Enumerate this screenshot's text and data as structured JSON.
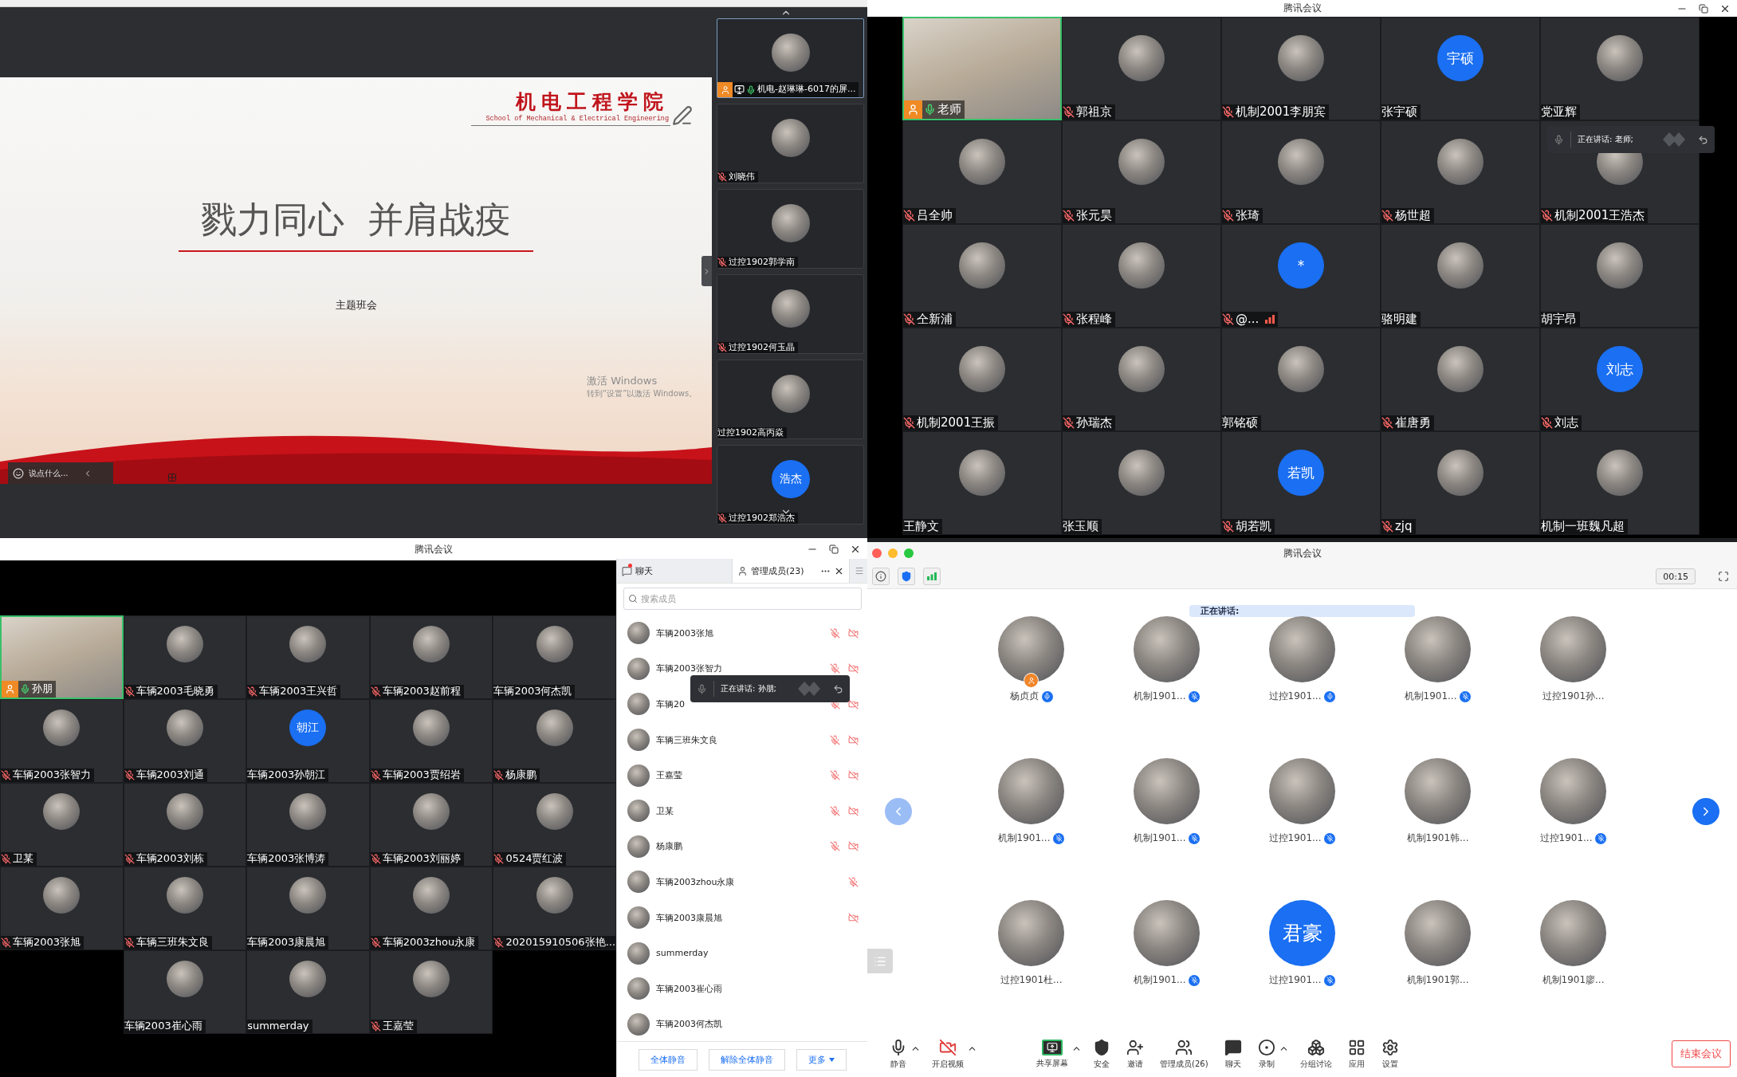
{
  "presentation_window": {
    "slide": {
      "logo_title": "机电工程学院",
      "logo_subtitle": "School of Mechanical & Electrical Engineering",
      "headline": "戮力同心  并肩战疫",
      "subtitle": "主题班会"
    },
    "os_notice": [
      "激活 Windows",
      "转到“设置”以激活 Windows。"
    ],
    "chat_input": {
      "placeholder": "说点什么..."
    },
    "filmstrip": [
      {
        "name": "机电-赵琳琳-6017的屏...",
        "kind": "photo",
        "mic_on": true,
        "mic_muted": false,
        "host": true,
        "sharing": true,
        "speaking": true
      },
      {
        "name": "刘晓伟",
        "kind": "photo",
        "mic_on": false,
        "mic_muted": true,
        "host": false,
        "sharing": false,
        "speaking": false
      },
      {
        "name": "过控1902郭学南",
        "kind": "photo",
        "mic_on": false,
        "mic_muted": true,
        "host": false,
        "sharing": false,
        "speaking": false
      },
      {
        "name": "过控1902何玉晶",
        "kind": "photo",
        "mic_on": false,
        "mic_muted": true,
        "host": false,
        "sharing": false,
        "speaking": false
      },
      {
        "name": "过控1902高丙焱",
        "kind": "photo",
        "mic_on": false,
        "mic_muted": false,
        "host": false,
        "sharing": false,
        "speaking": false
      },
      {
        "name": "过控1902郑浩杰",
        "kind": "initials",
        "initials": "浩杰",
        "mic_on": false,
        "mic_muted": true,
        "host": false,
        "sharing": false,
        "speaking": false
      }
    ]
  },
  "gallery_window_1": {
    "title": "腾讯会议",
    "speaking": "正在讲话: 老师;",
    "tiles": [
      {
        "name": "老师",
        "kind": "video",
        "mic_on": true,
        "mic_muted": false,
        "host": true,
        "speaking": true,
        "poor_network": false
      },
      {
        "name": "郭祖京",
        "kind": "photo",
        "mic_on": false,
        "mic_muted": true,
        "host": false,
        "speaking": false,
        "poor_network": false
      },
      {
        "name": "机制2001李朋宾",
        "kind": "photo",
        "mic_on": false,
        "mic_muted": true,
        "host": false,
        "speaking": false,
        "poor_network": false
      },
      {
        "name": "张宇硕",
        "kind": "initials",
        "initials": "宇硕",
        "mic_on": false,
        "mic_muted": false,
        "host": false,
        "speaking": false,
        "poor_network": false
      },
      {
        "name": "党亚辉",
        "kind": "photo",
        "mic_on": false,
        "mic_muted": false,
        "host": false,
        "speaking": false,
        "poor_network": false
      },
      {
        "name": "吕全帅",
        "kind": "photo",
        "mic_on": false,
        "mic_muted": true,
        "host": false,
        "speaking": false,
        "poor_network": false
      },
      {
        "name": "张元昊",
        "kind": "photo",
        "mic_on": false,
        "mic_muted": true,
        "host": false,
        "speaking": false,
        "poor_network": false
      },
      {
        "name": "张琦",
        "kind": "photo",
        "mic_on": false,
        "mic_muted": true,
        "host": false,
        "speaking": false,
        "poor_network": false
      },
      {
        "name": "杨世超",
        "kind": "photo",
        "mic_on": false,
        "mic_muted": true,
        "host": false,
        "speaking": false,
        "poor_network": false
      },
      {
        "name": "机制2001王浩杰",
        "kind": "photo",
        "mic_on": false,
        "mic_muted": true,
        "host": false,
        "speaking": false,
        "poor_network": false
      },
      {
        "name": "仝新浦",
        "kind": "photo",
        "mic_on": false,
        "mic_muted": true,
        "host": false,
        "speaking": false,
        "poor_network": false
      },
      {
        "name": "张程峰",
        "kind": "photo",
        "mic_on": false,
        "mic_muted": true,
        "host": false,
        "speaking": false,
        "poor_network": false
      },
      {
        "name": "@...",
        "kind": "initials",
        "initials": "*",
        "mic_on": false,
        "mic_muted": true,
        "host": false,
        "speaking": false,
        "poor_network": true
      },
      {
        "name": "骆明建",
        "kind": "photo",
        "mic_on": false,
        "mic_muted": false,
        "host": false,
        "speaking": false,
        "poor_network": false
      },
      {
        "name": "胡宇昂",
        "kind": "photo",
        "mic_on": false,
        "mic_muted": false,
        "host": false,
        "speaking": false,
        "poor_network": false
      },
      {
        "name": "机制2001王振",
        "kind": "photo",
        "mic_on": false,
        "mic_muted": true,
        "host": false,
        "speaking": false,
        "poor_network": false
      },
      {
        "name": "孙瑞杰",
        "kind": "photo",
        "mic_on": false,
        "mic_muted": true,
        "host": false,
        "speaking": false,
        "poor_network": false
      },
      {
        "name": "郭铭硕",
        "kind": "photo",
        "mic_on": false,
        "mic_muted": false,
        "host": false,
        "speaking": false,
        "poor_network": false
      },
      {
        "name": "崔唐勇",
        "kind": "photo",
        "mic_on": false,
        "mic_muted": true,
        "host": false,
        "speaking": false,
        "poor_network": false
      },
      {
        "name": "刘志",
        "kind": "initials",
        "initials": "刘志",
        "mic_on": false,
        "mic_muted": true,
        "host": false,
        "speaking": false,
        "poor_network": false
      },
      {
        "name": "王静文",
        "kind": "photo",
        "mic_on": false,
        "mic_muted": false,
        "host": false,
        "speaking": false,
        "poor_network": false
      },
      {
        "name": "张玉顺",
        "kind": "photo",
        "mic_on": false,
        "mic_muted": false,
        "host": false,
        "speaking": false,
        "poor_network": false
      },
      {
        "name": "胡若凯",
        "kind": "initials",
        "initials": "若凯",
        "mic_on": false,
        "mic_muted": true,
        "host": false,
        "speaking": false,
        "poor_network": false
      },
      {
        "name": "zjq",
        "kind": "photo",
        "mic_on": false,
        "mic_muted": true,
        "host": false,
        "speaking": false,
        "poor_network": false
      },
      {
        "name": "机制一班魏凡超",
        "kind": "photo",
        "mic_on": false,
        "mic_muted": false,
        "host": false,
        "speaking": false,
        "poor_network": false
      }
    ]
  },
  "gallery_window_2": {
    "title": "腾讯会议",
    "tiles": [
      {
        "name": "孙朋",
        "kind": "video",
        "mic_on": true,
        "mic_muted": false,
        "host": true,
        "speaking": true
      },
      {
        "name": "车辆2003毛晓勇",
        "kind": "photo",
        "mic_on": false,
        "mic_muted": true,
        "host": false,
        "speaking": false
      },
      {
        "name": "车辆2003王兴哲",
        "kind": "photo",
        "mic_on": false,
        "mic_muted": true,
        "host": false,
        "speaking": false
      },
      {
        "name": "车辆2003赵前程",
        "kind": "photo",
        "mic_on": false,
        "mic_muted": true,
        "host": false,
        "speaking": false
      },
      {
        "name": "车辆2003何杰凯",
        "kind": "photo",
        "mic_on": false,
        "mic_muted": false,
        "host": false,
        "speaking": false
      },
      {
        "name": "车辆2003张智力",
        "kind": "photo",
        "mic_on": false,
        "mic_muted": true,
        "host": false,
        "speaking": false
      },
      {
        "name": "车辆2003刘通",
        "kind": "photo",
        "mic_on": false,
        "mic_muted": true,
        "host": false,
        "speaking": false
      },
      {
        "name": "车辆2003孙朝江",
        "kind": "initials",
        "initials": "朝江",
        "mic_on": false,
        "mic_muted": false,
        "host": false,
        "speaking": false
      },
      {
        "name": "车辆2003贾绍岩",
        "kind": "photo",
        "mic_on": false,
        "mic_muted": true,
        "host": false,
        "speaking": false
      },
      {
        "name": "杨康鹏",
        "kind": "photo",
        "mic_on": false,
        "mic_muted": true,
        "host": false,
        "speaking": false
      },
      {
        "name": "卫某",
        "kind": "photo",
        "mic_on": false,
        "mic_muted": true,
        "host": false,
        "speaking": false
      },
      {
        "name": "车辆2003刘栋",
        "kind": "photo",
        "mic_on": false,
        "mic_muted": true,
        "host": false,
        "speaking": false
      },
      {
        "name": "车辆2003张博涛",
        "kind": "photo",
        "mic_on": false,
        "mic_muted": false,
        "host": false,
        "speaking": false
      },
      {
        "name": "车辆2003刘丽婷",
        "kind": "photo",
        "mic_on": false,
        "mic_muted": true,
        "host": false,
        "speaking": false
      },
      {
        "name": "0524贾红波",
        "kind": "photo",
        "mic_on": false,
        "mic_muted": true,
        "host": false,
        "speaking": false
      },
      {
        "name": "车辆2003张旭",
        "kind": "photo",
        "mic_on": false,
        "mic_muted": true,
        "host": false,
        "speaking": false
      },
      {
        "name": "车辆三班朱文良",
        "kind": "photo",
        "mic_on": false,
        "mic_muted": true,
        "host": false,
        "speaking": false
      },
      {
        "name": "车辆2003康晨旭",
        "kind": "photo",
        "mic_on": false,
        "mic_muted": false,
        "host": false,
        "speaking": false
      },
      {
        "name": "车辆2003zhou永康",
        "kind": "photo",
        "mic_on": false,
        "mic_muted": true,
        "host": false,
        "speaking": false
      },
      {
        "name": "202015910506张艳...",
        "kind": "photo",
        "mic_on": false,
        "mic_muted": true,
        "host": false,
        "speaking": false
      },
      {
        "name": "车辆2003崔心雨",
        "kind": "photo",
        "mic_on": false,
        "mic_muted": false,
        "host": false,
        "speaking": false
      },
      {
        "name": "summerday",
        "kind": "photo",
        "mic_on": false,
        "mic_muted": false,
        "host": false,
        "speaking": false
      },
      {
        "name": "王嘉莹",
        "kind": "photo",
        "mic_on": false,
        "mic_muted": true,
        "host": false,
        "speaking": false
      }
    ]
  },
  "member_panel": {
    "tabs": [
      {
        "label": "聊天",
        "selected": false,
        "unread": true
      },
      {
        "label": "管理成员(23)",
        "selected": true,
        "unread": false
      }
    ],
    "search": {
      "placeholder": "搜索成员"
    },
    "speaking": "正在讲话: 孙朋;",
    "members": [
      {
        "name": "车辆2003张旭",
        "mic_muted": true,
        "camera_off": true
      },
      {
        "name": "车辆2003张智力",
        "mic_muted": true,
        "camera_off": true
      },
      {
        "name": "车辆20",
        "mic_muted": true,
        "camera_off": true
      },
      {
        "name": "车辆三班朱文良",
        "mic_muted": true,
        "camera_off": true
      },
      {
        "name": "王嘉莹",
        "mic_muted": true,
        "camera_off": true
      },
      {
        "name": "卫某",
        "mic_muted": true,
        "camera_off": true
      },
      {
        "name": "杨康鹏",
        "mic_muted": true,
        "camera_off": true
      },
      {
        "name": "车辆2003zhou永康",
        "mic_muted": true,
        "camera_off": false
      },
      {
        "name": "车辆2003康晨旭",
        "mic_muted": false,
        "camera_off": true
      },
      {
        "name": "summerday",
        "mic_muted": false,
        "camera_off": false
      },
      {
        "name": "车辆2003崔心雨",
        "mic_muted": false,
        "camera_off": false
      },
      {
        "name": "车辆2003何杰凯",
        "mic_muted": false,
        "camera_off": false
      }
    ],
    "buttons": [
      "全体静音",
      "解除全体静音",
      "更多"
    ]
  },
  "mac_window": {
    "title": "腾讯会议",
    "timer": "00:15",
    "speaking": "正在讲话:",
    "nav": {
      "prev_disabled": true,
      "next_disabled": false
    },
    "participants": [
      {
        "name": "杨贞贞",
        "kind": "photo",
        "mic_on": true,
        "mic_muted": false,
        "host": true
      },
      {
        "name": "机制1901...",
        "kind": "photo",
        "mic_on": false,
        "mic_muted": true,
        "host": false
      },
      {
        "name": "过控1901...",
        "kind": "photo",
        "mic_on": true,
        "mic_muted": false,
        "host": false
      },
      {
        "name": "机制1901...",
        "kind": "photo",
        "mic_on": false,
        "mic_muted": true,
        "host": false
      },
      {
        "name": "过控1901孙...",
        "kind": "photo",
        "mic_on": false,
        "mic_muted": false,
        "host": false
      },
      {
        "name": "机制1901...",
        "kind": "photo",
        "mic_on": false,
        "mic_muted": true,
        "host": false
      },
      {
        "name": "机制1901...",
        "kind": "photo",
        "mic_on": false,
        "mic_muted": true,
        "host": false
      },
      {
        "name": "过控1901...",
        "kind": "photo",
        "mic_on": false,
        "mic_muted": true,
        "host": false
      },
      {
        "name": "机制1901韩...",
        "kind": "photo",
        "mic_on": false,
        "mic_muted": false,
        "host": false
      },
      {
        "name": "过控1901...",
        "kind": "photo",
        "mic_on": false,
        "mic_muted": true,
        "host": false
      },
      {
        "name": "过控1901杜...",
        "kind": "photo",
        "mic_on": false,
        "mic_muted": false,
        "host": false
      },
      {
        "name": "机制1901...",
        "kind": "photo",
        "mic_on": false,
        "mic_muted": true,
        "host": false
      },
      {
        "name": "过控1901...",
        "kind": "initials",
        "initials": "君豪",
        "mic_on": false,
        "mic_muted": true,
        "host": false
      },
      {
        "name": "机制1901郭...",
        "kind": "photo",
        "mic_on": false,
        "mic_muted": false,
        "host": false
      },
      {
        "name": "机制1901廖...",
        "kind": "photo",
        "mic_on": false,
        "mic_muted": false,
        "host": false
      }
    ],
    "toolbar": [
      {
        "label": "静音",
        "kind": "mic",
        "has_menu": true
      },
      {
        "label": "开启视频",
        "kind": "video_off",
        "has_menu": true
      },
      {
        "label": "共享屏幕",
        "kind": "share",
        "has_menu": true
      },
      {
        "label": "安全",
        "kind": "security",
        "has_menu": false
      },
      {
        "label": "邀请",
        "kind": "invite",
        "has_menu": false
      },
      {
        "label": "管理成员(26)",
        "kind": "members",
        "has_menu": false
      },
      {
        "label": "聊天",
        "kind": "chat",
        "has_menu": false
      },
      {
        "label": "录制",
        "kind": "record",
        "has_menu": true
      },
      {
        "label": "分组讨论",
        "kind": "breakout",
        "has_menu": false
      },
      {
        "label": "应用",
        "kind": "apps",
        "has_menu": false
      },
      {
        "label": "设置",
        "kind": "settings",
        "has_menu": false
      }
    ],
    "end_button": "结束会议"
  }
}
